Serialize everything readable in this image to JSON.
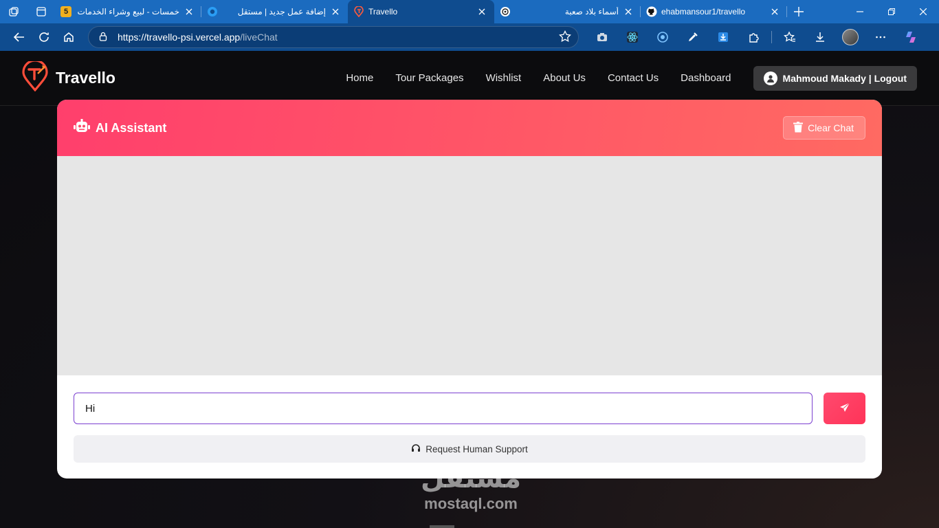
{
  "browser": {
    "tabs": [
      {
        "title": "خمسات - لبيع وشراء الخدمات",
        "favicon": "khamsat-icon",
        "favicon_text": "5",
        "rtl": true
      },
      {
        "title": "إضافة عمل جديد | مستقل",
        "favicon": "mostaql-icon",
        "rtl": true
      },
      {
        "title": "Travello",
        "favicon": "travello-icon",
        "active": true
      },
      {
        "title": "أسماء بلاد صعبة",
        "favicon": "chatgpt-icon",
        "rtl": true
      },
      {
        "title": "ehabmansour1/travello",
        "favicon": "github-icon"
      }
    ],
    "address": {
      "url_host": "https://travello-psi.vercel.app",
      "url_path": "/liveChat"
    }
  },
  "site": {
    "brand": "Travello",
    "nav": [
      "Home",
      "Tour Packages",
      "Wishlist",
      "About Us",
      "Contact Us",
      "Dashboard"
    ],
    "user_button": "Mahmoud Makady | Logout"
  },
  "chat": {
    "title": "AI Assistant",
    "clear_label": "Clear Chat",
    "input_value": "Hi",
    "support_label": "Request Human Support"
  },
  "watermark": {
    "arabic": "مستقل",
    "latin": "mostaql.com"
  },
  "colors": {
    "accent": "#ff4a6e",
    "input_border": "#7b3fd0",
    "tabstrip": "#1b6bbf",
    "toolbar": "#0f4c8f"
  }
}
